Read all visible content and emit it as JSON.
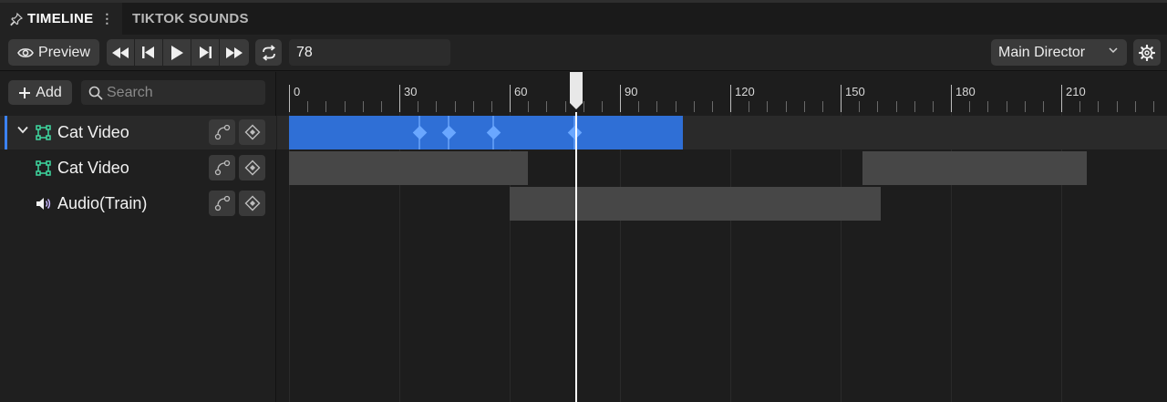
{
  "tabs": [
    {
      "label": "TIMELINE",
      "active": true
    },
    {
      "label": "TIKTOK SOUNDS",
      "active": false
    }
  ],
  "toolbar": {
    "preview_label": "Preview",
    "frame_value": "78",
    "director_label": "Main Director"
  },
  "left_panel": {
    "add_label": "Add",
    "search_placeholder": "Search"
  },
  "tracks": [
    {
      "name": "Cat Video",
      "type": "group",
      "expanded": true,
      "selected": true
    },
    {
      "name": "Cat Video",
      "type": "video",
      "selected": false
    },
    {
      "name": "Audio(Train)",
      "type": "audio",
      "selected": false
    }
  ],
  "ruler": {
    "labels": [
      "0",
      "30",
      "60",
      "90",
      "120",
      "150",
      "180",
      "210"
    ],
    "playhead_frame": 78
  },
  "clips": [
    {
      "track": 0,
      "start": 0,
      "end": 107,
      "kind": "main"
    },
    {
      "track": 1,
      "start": 0,
      "end": 65,
      "kind": "normal"
    },
    {
      "track": 1,
      "start": 156,
      "end": 217,
      "kind": "normal"
    },
    {
      "track": 2,
      "start": 60,
      "end": 161,
      "kind": "normal"
    }
  ],
  "keyframes": [
    35.5,
    43.5,
    55.5,
    77.5
  ],
  "colors": {
    "accent": "#2f6fd6",
    "keyframe": "#6aa7ff",
    "selection_bar": "#3b82f6",
    "icon_green": "#3fd8a0",
    "audio_icon": "#c9b8ff"
  }
}
